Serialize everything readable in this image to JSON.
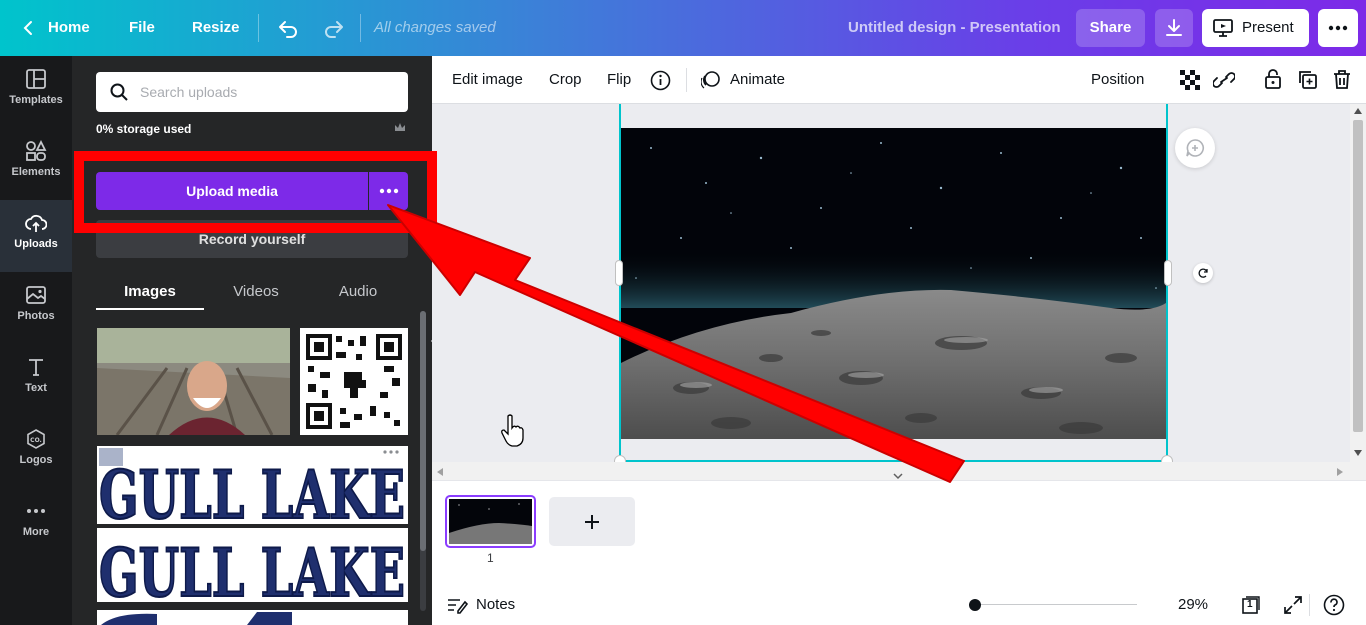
{
  "topbar": {
    "home_label": "Home",
    "file_label": "File",
    "resize_label": "Resize",
    "saved_status": "All changes saved",
    "design_title": "Untitled design - Presentation",
    "share_label": "Share",
    "present_label": "Present"
  },
  "rail": {
    "items": [
      {
        "label": "Templates",
        "icon": "templates-icon"
      },
      {
        "label": "Elements",
        "icon": "elements-icon"
      },
      {
        "label": "Uploads",
        "icon": "upload-cloud-icon"
      },
      {
        "label": "Photos",
        "icon": "photos-icon"
      },
      {
        "label": "Text",
        "icon": "text-icon"
      },
      {
        "label": "Logos",
        "icon": "logos-icon"
      },
      {
        "label": "More",
        "icon": "more-dots-icon"
      }
    ],
    "active": "Uploads"
  },
  "panel": {
    "search_placeholder": "Search uploads",
    "storage_text": "0% storage used",
    "upload_label": "Upload media",
    "record_label": "Record yourself",
    "tabs": [
      "Images",
      "Videos",
      "Audio"
    ],
    "active_tab": "Images",
    "logo_text_1": "GULL LAKE",
    "logo_text_2": "GULL LAKE"
  },
  "toolbar": {
    "edit_image": "Edit image",
    "crop": "Crop",
    "flip": "Flip",
    "animate": "Animate",
    "position": "Position"
  },
  "pages": {
    "page_number": "1",
    "page_count_badge": "1"
  },
  "footer": {
    "notes_label": "Notes",
    "zoom": "29%"
  },
  "colors": {
    "accent": "#7d2ae8",
    "annotation_red": "#ff0000",
    "selection": "#00c4cc"
  }
}
